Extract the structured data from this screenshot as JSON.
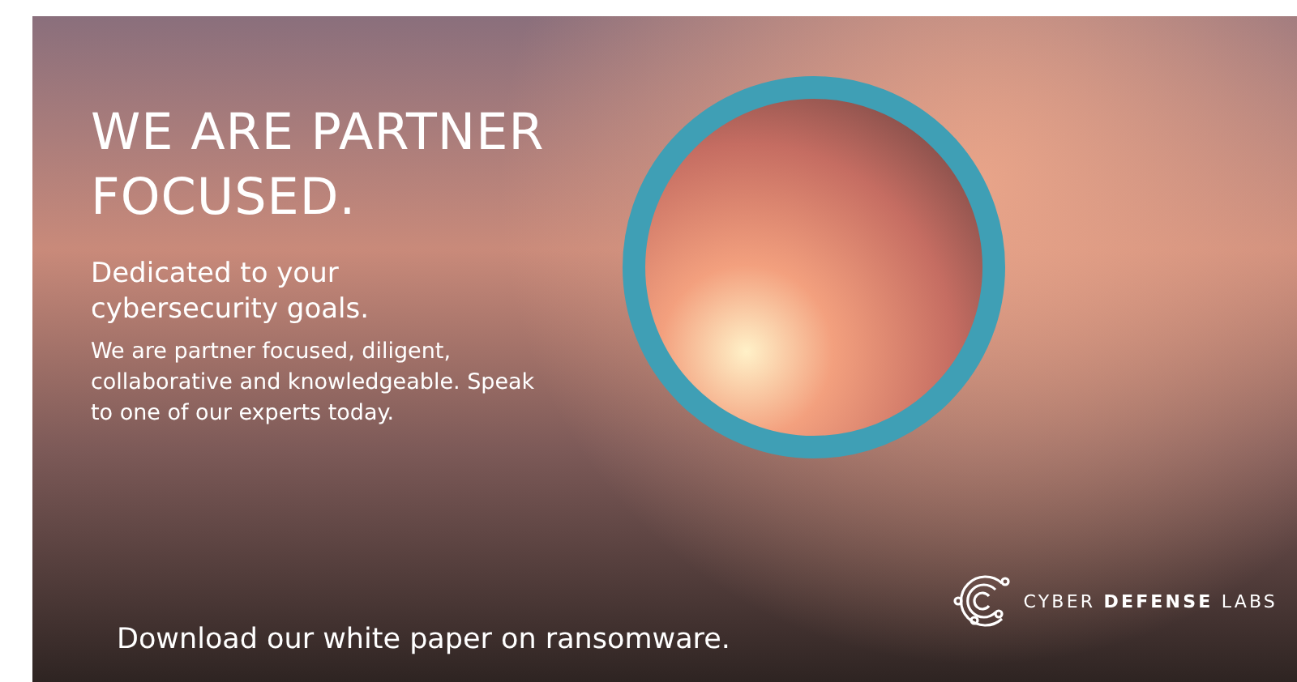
{
  "banner": {
    "headline": "WE ARE PARTNER FOCUSED.",
    "subheading": "Dedicated to your cybersecurity goals.",
    "body": "We are partner focused, diligent, collaborative and knowledgeable. Speak to one of our experts today.",
    "call_to_action": "Download our white paper on ransomware.",
    "logo_text": "CYBER **DEFENSE** LABS"
  }
}
